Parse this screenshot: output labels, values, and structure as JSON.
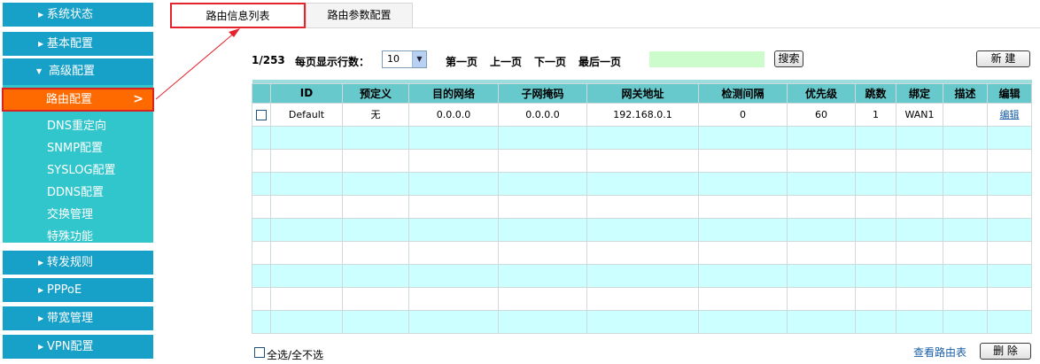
{
  "sidebar": {
    "system_status": "系统状态",
    "basic_config": "基本配置",
    "advanced_config": "高级配置",
    "advanced_sub": {
      "active": "路由配置",
      "items": [
        "DNS重定向",
        "SNMP配置",
        "SYSLOG配置",
        "DDNS配置",
        "交换管理",
        "特殊功能"
      ]
    },
    "forward_rules": "转发规则",
    "pppoe": "PPPoE",
    "bandwidth": "带宽管理",
    "vpn": "VPN配置"
  },
  "tabs": {
    "list": "路由信息列表",
    "params": "路由参数配置"
  },
  "toolbar": {
    "page_indicator": "1/253",
    "rows_label": "每页显示行数：",
    "rows_value": "10",
    "first": "第一页",
    "prev": "上一页",
    "next": "下一页",
    "last": "最后一页",
    "search_value": "",
    "search_btn": "搜索",
    "new_btn": "新 建"
  },
  "table": {
    "headers": [
      "",
      "ID",
      "预定义",
      "目的网络",
      "子网掩码",
      "网关地址",
      "检测间隔",
      "优先级",
      "跳数",
      "绑定",
      "描述",
      "编辑"
    ],
    "row": {
      "id": "Default",
      "predefined": "无",
      "dest": "0.0.0.0",
      "mask": "0.0.0.0",
      "gateway": "192.168.0.1",
      "interval": "0",
      "priority": "60",
      "hops": "1",
      "bind": "WAN1",
      "desc": "",
      "edit": "编辑"
    }
  },
  "footer": {
    "select_all": "全选/全不选",
    "view_route": "查看路由表",
    "delete_btn": "删 除"
  },
  "colors": {
    "menu_blue": "#17a0c8",
    "submenu_teal": "#31c6cc",
    "active_orange": "#ff6a00",
    "header_teal": "#67c9cc",
    "row_alt": "#ccffff"
  }
}
